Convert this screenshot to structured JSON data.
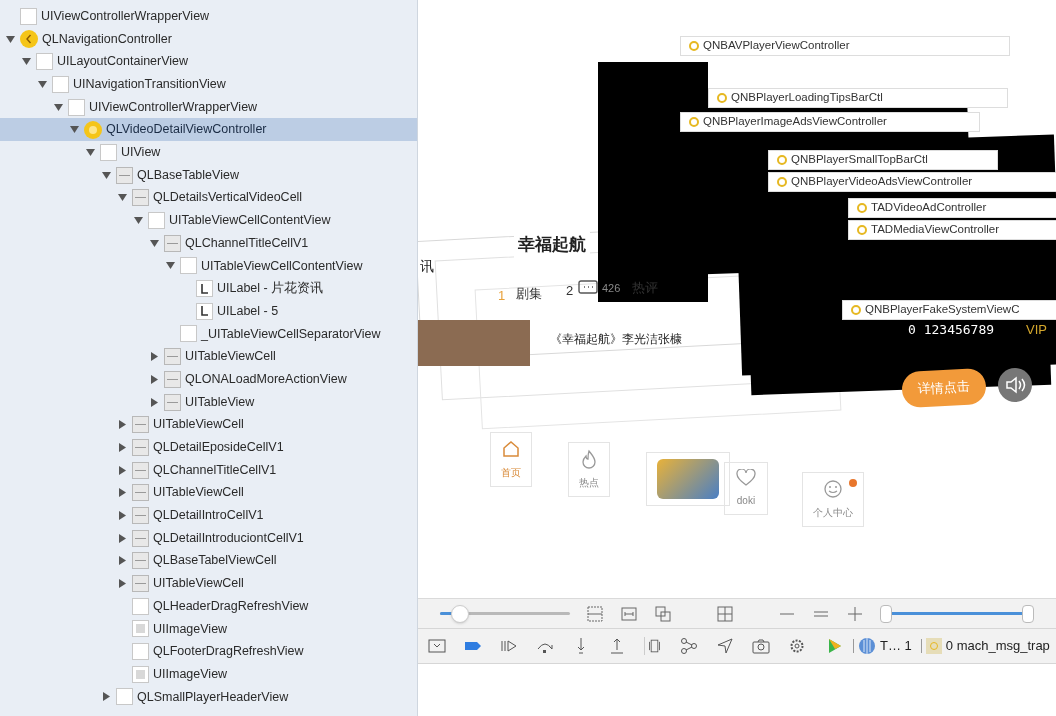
{
  "tree": [
    {
      "label": "UIViewControllerWrapperView",
      "kind": "view",
      "selected": false
    },
    {
      "label": "QLNavigationController",
      "kind": "navigation",
      "selected": false,
      "expanded": true,
      "children": [
        {
          "label": "UILayoutContainerView",
          "kind": "view",
          "selected": false,
          "expanded": true,
          "children": [
            {
              "label": "UINavigationTransitionView",
              "kind": "view",
              "selected": false,
              "expanded": true,
              "children": [
                {
                  "label": "UIViewControllerWrapperView",
                  "kind": "view",
                  "selected": false,
                  "expanded": true,
                  "children": [
                    {
                      "label": "QLVideoDetailViewController",
                      "kind": "controller",
                      "selected": true,
                      "expanded": true,
                      "children": [
                        {
                          "label": "UIView",
                          "kind": "view",
                          "selected": false,
                          "expanded": true,
                          "children": [
                            {
                              "label": "QLBaseTableView",
                              "kind": "table",
                              "selected": false,
                              "expanded": true,
                              "children": [
                                {
                                  "label": "QLDetailsVerticalVideoCell",
                                  "kind": "table",
                                  "selected": false,
                                  "expanded": true,
                                  "children": [
                                    {
                                      "label": "UITableViewCellContentView",
                                      "kind": "view",
                                      "selected": false,
                                      "expanded": true,
                                      "children": [
                                        {
                                          "label": "QLChannelTitleCellV1",
                                          "kind": "table",
                                          "selected": false,
                                          "expanded": true,
                                          "children": [
                                            {
                                              "label": "UITableViewCellContentView",
                                              "kind": "view",
                                              "selected": false,
                                              "expanded": true,
                                              "children": [
                                                {
                                                  "label": "UILabel - 片花资讯",
                                                  "kind": "label",
                                                  "selected": false
                                                },
                                                {
                                                  "label": "UILabel - 5",
                                                  "kind": "label",
                                                  "selected": false
                                                }
                                              ]
                                            },
                                            {
                                              "label": "_UITableViewCellSeparatorView",
                                              "kind": "view",
                                              "selected": false
                                            }
                                          ]
                                        },
                                        {
                                          "label": "UITableViewCell",
                                          "kind": "table",
                                          "selected": false,
                                          "expanded": false
                                        },
                                        {
                                          "label": "QLONALoadMoreActionView",
                                          "kind": "table",
                                          "selected": false,
                                          "expanded": false
                                        },
                                        {
                                          "label": "UITableView",
                                          "kind": "table",
                                          "selected": false,
                                          "expanded": false
                                        }
                                      ]
                                    }
                                  ]
                                },
                                {
                                  "label": "UITableViewCell",
                                  "kind": "table",
                                  "selected": false,
                                  "expanded": false
                                },
                                {
                                  "label": "QLDetailEposideCellV1",
                                  "kind": "table",
                                  "selected": false,
                                  "expanded": false
                                },
                                {
                                  "label": "QLChannelTitleCellV1",
                                  "kind": "table",
                                  "selected": false,
                                  "expanded": false
                                },
                                {
                                  "label": "UITableViewCell",
                                  "kind": "table",
                                  "selected": false,
                                  "expanded": false
                                },
                                {
                                  "label": "QLDetailIntroCellV1",
                                  "kind": "table",
                                  "selected": false,
                                  "expanded": false
                                },
                                {
                                  "label": "QLDetailIntroduciontCellV1",
                                  "kind": "table",
                                  "selected": false,
                                  "expanded": false
                                },
                                {
                                  "label": "QLBaseTabelViewCell",
                                  "kind": "table",
                                  "selected": false,
                                  "expanded": false
                                },
                                {
                                  "label": "UITableViewCell",
                                  "kind": "table",
                                  "selected": false,
                                  "expanded": false
                                },
                                {
                                  "label": "QLHeaderDragRefreshView",
                                  "kind": "view",
                                  "selected": false
                                },
                                {
                                  "label": "UIImageView",
                                  "kind": "image",
                                  "selected": false
                                },
                                {
                                  "label": "QLFooterDragRefreshView",
                                  "kind": "view",
                                  "selected": false
                                },
                                {
                                  "label": "UIImageView",
                                  "kind": "image",
                                  "selected": false
                                }
                              ]
                            },
                            {
                              "label": "QLSmallPlayerHeaderView",
                              "kind": "view",
                              "selected": false,
                              "expanded": false
                            }
                          ]
                        }
                      ]
                    }
                  ]
                }
              ]
            }
          ]
        }
      ]
    }
  ],
  "canvas": {
    "layers": [
      {
        "label": "QNBAVPlayerViewController"
      },
      {
        "label": "QNBPlayerLoadingTipsBarCtl"
      },
      {
        "label": "QNBPlayerImageAdsViewController"
      },
      {
        "label": "QNBPlayerSmallTopBarCtl"
      },
      {
        "label": "QNBPlayerVideoAdsViewController"
      },
      {
        "label": "TADVideoAdController"
      },
      {
        "label": "TADMediaViewController"
      },
      {
        "label": "QNBPlayerFakeSystemViewC"
      }
    ],
    "texts": [
      {
        "kind": "side",
        "text": "讯"
      },
      {
        "kind": "title",
        "text": "幸福起航"
      },
      {
        "kind": "number",
        "text": "1"
      },
      {
        "kind": "tab",
        "text": "剧集"
      },
      {
        "kind": "tab",
        "text": "2"
      },
      {
        "kind": "count",
        "text": "426"
      },
      {
        "kind": "tab",
        "text": "热评"
      },
      {
        "kind": "caption",
        "text": "《幸福起航》李光洁张槺"
      },
      {
        "kind": "digits",
        "text": "0 123456789"
      },
      {
        "kind": "vip",
        "text": "VIP"
      }
    ],
    "detail_button": "详情点击",
    "tab_bar": [
      {
        "label": "首页",
        "kind": "home",
        "badge": false
      },
      {
        "label": "热点",
        "kind": "flame",
        "badge": false
      },
      {
        "kind": "logo",
        "badge": false
      },
      {
        "label": "doki",
        "kind": "heart",
        "badge": false
      },
      {
        "label": "个人中心",
        "kind": "face",
        "badge": true
      }
    ]
  },
  "controls": {
    "spacing": {
      "level": 0.15
    },
    "range": {
      "level": 1.0
    }
  },
  "debug_bar": {
    "thread": "T… 1",
    "frame": "0 mach_msg_trap"
  }
}
